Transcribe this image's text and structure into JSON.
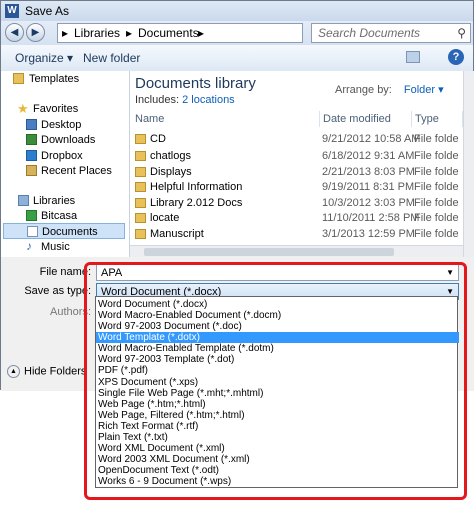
{
  "window": {
    "title": "Save As",
    "app_icon_letter": "W"
  },
  "address": {
    "back_glyph": "◀",
    "forward_glyph": "▶",
    "segments": [
      "▸",
      "Libraries",
      "▸",
      "Documents",
      "▸"
    ],
    "search_placeholder": "Search Documents"
  },
  "toolbar": {
    "organize": "Organize ▾",
    "new_folder": "New folder",
    "help": "?"
  },
  "nav": {
    "items": [
      {
        "label": "Templates",
        "icon": "folder-icon"
      },
      {
        "label": "Favorites",
        "icon": "star-icon"
      },
      {
        "label": "Desktop",
        "icon": "desktop-icon"
      },
      {
        "label": "Downloads",
        "icon": "downloads-icon"
      },
      {
        "label": "Dropbox",
        "icon": "dropbox-icon"
      },
      {
        "label": "Recent Places",
        "icon": "recent-places-icon"
      },
      {
        "label": "Libraries",
        "icon": "libraries-icon"
      },
      {
        "label": "Bitcasa",
        "icon": "bitcasa-icon"
      },
      {
        "label": "Documents",
        "icon": "documents-icon"
      },
      {
        "label": "Music",
        "icon": "music-icon"
      }
    ]
  },
  "content": {
    "library_title": "Documents library",
    "includes_label": "Includes:",
    "includes_link": "2 locations",
    "arrange_by_label": "Arrange by:",
    "arrange_by_value": "Folder ▾",
    "columns": [
      "Name",
      "Date modified",
      "Type"
    ],
    "files": [
      {
        "name": "CD",
        "date": "9/21/2012 10:58 AM",
        "type": "File folde"
      },
      {
        "name": "chatlogs",
        "date": "6/18/2012 9:31 AM",
        "type": "File folde"
      },
      {
        "name": "Displays",
        "date": "2/21/2013 8:03 PM",
        "type": "File folde"
      },
      {
        "name": "Helpful Information",
        "date": "9/19/2011 8:31 PM",
        "type": "File folde"
      },
      {
        "name": "Library 2.012 Docs",
        "date": "10/3/2012 3:03 PM",
        "type": "File folde"
      },
      {
        "name": "locate",
        "date": "11/10/2011 2:58 PM",
        "type": "File folde"
      },
      {
        "name": "Manuscript",
        "date": "3/1/2013 12:59 PM",
        "type": "File folde"
      }
    ]
  },
  "form": {
    "file_name_label": "File name:",
    "file_name_value": "APA",
    "save_as_type_label": "Save as type:",
    "save_as_type_value": "Word Document (*.docx)",
    "authors_label": "Authors:",
    "hide_folders": "Hide Folders"
  },
  "type_options": [
    "Word Document (*.docx)",
    "Word Macro-Enabled Document (*.docm)",
    "Word 97-2003 Document (*.doc)",
    "Word Template (*.dotx)",
    "Word Macro-Enabled Template (*.dotm)",
    "Word 97-2003 Template (*.dot)",
    "PDF (*.pdf)",
    "XPS Document (*.xps)",
    "Single File Web Page (*.mht;*.mhtml)",
    "Web Page (*.htm;*.html)",
    "Web Page, Filtered (*.htm;*.html)",
    "Rich Text Format (*.rtf)",
    "Plain Text (*.txt)",
    "Word XML Document (*.xml)",
    "Word 2003 XML Document (*.xml)",
    "OpenDocument Text (*.odt)",
    "Works 6 - 9 Document (*.wps)"
  ],
  "selected_option_index": 3,
  "colors": {
    "highlight": "#e3171c",
    "selection": "#3399ff",
    "link": "#0c5fb8"
  }
}
